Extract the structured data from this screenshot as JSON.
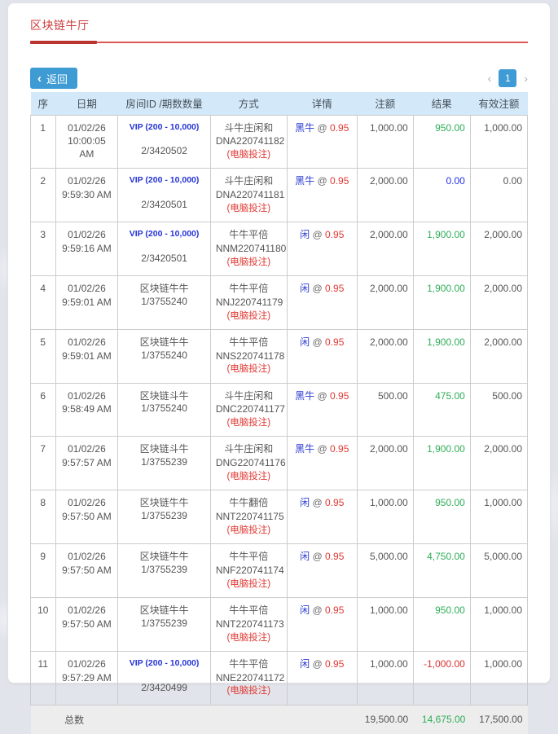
{
  "page": {
    "title": "区块链牛厅",
    "back": {
      "icon": "‹",
      "label": "返回"
    },
    "pagination": {
      "prev": "‹",
      "current": "1",
      "next": "›"
    }
  },
  "colors": {
    "accent_blue": "#3e9bd4",
    "title_red": "#cc3b3b",
    "pick_blue": "#2b3bd2",
    "odds_red": "#e03a34",
    "result_green": "#2fae58",
    "result_loss_red": "#d93030",
    "result_zero_blue": "#2330e0",
    "header_bg": "#d3e8f8"
  },
  "table": {
    "headers": [
      "序",
      "日期",
      "房间ID /期数数量",
      "方式",
      "详情",
      "注额",
      "结果",
      "有效注额"
    ],
    "rows": [
      {
        "no": "1",
        "date": "01/02/26",
        "time": "10:00:05 AM",
        "room": "VIP (200 - 10,000)",
        "room_vip": true,
        "period": "2/3420502",
        "game": "斗牛庄闲和",
        "code": "DNA220741182",
        "note": "(电脑投注)",
        "pick": "黑牛",
        "at": "@",
        "odds": "0.95",
        "amount": "1,000.00",
        "result": "950.00",
        "result_color": "green",
        "valid": "1,000.00"
      },
      {
        "no": "2",
        "date": "01/02/26",
        "time": "9:59:30 AM",
        "room": "VIP (200 - 10,000)",
        "room_vip": true,
        "period": "2/3420501",
        "game": "斗牛庄闲和",
        "code": "DNA220741181",
        "note": "(电脑投注)",
        "pick": "黑牛",
        "at": "@",
        "odds": "0.95",
        "amount": "2,000.00",
        "result": "0.00",
        "result_color": "blue",
        "valid": "0.00"
      },
      {
        "no": "3",
        "date": "01/02/26",
        "time": "9:59:16 AM",
        "room": "VIP (200 - 10,000)",
        "room_vip": true,
        "period": "2/3420501",
        "game": "牛牛平倍",
        "code": "NNM220741180",
        "note": "(电脑投注)",
        "pick": "闲",
        "at": "@",
        "odds": "0.95",
        "amount": "2,000.00",
        "result": "1,900.00",
        "result_color": "green",
        "valid": "2,000.00"
      },
      {
        "no": "4",
        "date": "01/02/26",
        "time": "9:59:01 AM",
        "room": "区块链牛牛",
        "room_vip": false,
        "period": "1/3755240",
        "game": "牛牛平倍",
        "code": "NNJ220741179",
        "note": "(电脑投注)",
        "pick": "闲",
        "at": "@",
        "odds": "0.95",
        "amount": "2,000.00",
        "result": "1,900.00",
        "result_color": "green",
        "valid": "2,000.00"
      },
      {
        "no": "5",
        "date": "01/02/26",
        "time": "9:59:01 AM",
        "room": "区块链牛牛",
        "room_vip": false,
        "period": "1/3755240",
        "game": "牛牛平倍",
        "code": "NNS220741178",
        "note": "(电脑投注)",
        "pick": "闲",
        "at": "@",
        "odds": "0.95",
        "amount": "2,000.00",
        "result": "1,900.00",
        "result_color": "green",
        "valid": "2,000.00"
      },
      {
        "no": "6",
        "date": "01/02/26",
        "time": "9:58:49 AM",
        "room": "区块链斗牛",
        "room_vip": false,
        "period": "1/3755240",
        "game": "斗牛庄闲和",
        "code": "DNC220741177",
        "note": "(电脑投注)",
        "pick": "黑牛",
        "at": "@",
        "odds": "0.95",
        "amount": "500.00",
        "result": "475.00",
        "result_color": "green",
        "valid": "500.00"
      },
      {
        "no": "7",
        "date": "01/02/26",
        "time": "9:57:57 AM",
        "room": "区块链斗牛",
        "room_vip": false,
        "period": "1/3755239",
        "game": "斗牛庄闲和",
        "code": "DNG220741176",
        "note": "(电脑投注)",
        "pick": "黑牛",
        "at": "@",
        "odds": "0.95",
        "amount": "2,000.00",
        "result": "1,900.00",
        "result_color": "green",
        "valid": "2,000.00"
      },
      {
        "no": "8",
        "date": "01/02/26",
        "time": "9:57:50 AM",
        "room": "区块链牛牛",
        "room_vip": false,
        "period": "1/3755239",
        "game": "牛牛翻倍",
        "code": "NNT220741175",
        "note": "(电脑投注)",
        "pick": "闲",
        "at": "@",
        "odds": "0.95",
        "amount": "1,000.00",
        "result": "950.00",
        "result_color": "green",
        "valid": "1,000.00"
      },
      {
        "no": "9",
        "date": "01/02/26",
        "time": "9:57:50 AM",
        "room": "区块链牛牛",
        "room_vip": false,
        "period": "1/3755239",
        "game": "牛牛平倍",
        "code": "NNF220741174",
        "note": "(电脑投注)",
        "pick": "闲",
        "at": "@",
        "odds": "0.95",
        "amount": "5,000.00",
        "result": "4,750.00",
        "result_color": "green",
        "valid": "5,000.00"
      },
      {
        "no": "10",
        "date": "01/02/26",
        "time": "9:57:50 AM",
        "room": "区块链牛牛",
        "room_vip": false,
        "period": "1/3755239",
        "game": "牛牛平倍",
        "code": "NNT220741173",
        "note": "(电脑投注)",
        "pick": "闲",
        "at": "@",
        "odds": "0.95",
        "amount": "1,000.00",
        "result": "950.00",
        "result_color": "green",
        "valid": "1,000.00"
      },
      {
        "no": "11",
        "date": "01/02/26",
        "time": "9:57:29 AM",
        "room": "VIP (200 - 10,000)",
        "room_vip": true,
        "period": "2/3420499",
        "game": "牛牛平倍",
        "code": "NNE220741172",
        "note": "(电脑投注)",
        "pick": "闲",
        "at": "@",
        "odds": "0.95",
        "amount": "1,000.00",
        "result": "-1,000.00",
        "result_color": "red",
        "valid": "1,000.00"
      }
    ],
    "total": {
      "label": "总数",
      "amount": "19,500.00",
      "result": "14,675.00",
      "valid": "17,500.00"
    }
  }
}
